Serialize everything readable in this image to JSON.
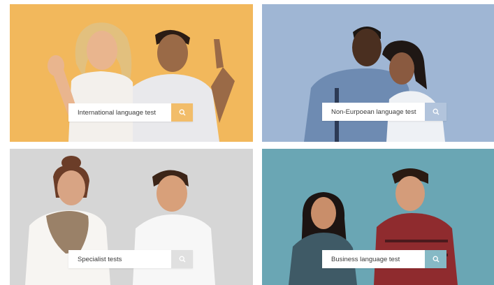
{
  "colors": {
    "card1_bg": "#f2b85c",
    "card2_bg": "#9fb6d4",
    "card3_bg": "#d4d4d4",
    "card4_bg": "#6aa6b4",
    "card1_button": "#f2bd6a",
    "card2_button": "#b2c4dc",
    "card3_button": "#e0e0e0",
    "card4_button": "#86b9c5"
  },
  "cards": [
    {
      "search_label": "International language test",
      "button_icon": "search-icon"
    },
    {
      "search_label": "Non-Eurpoean language test",
      "button_icon": "search-icon"
    },
    {
      "search_label": "Specialist tests",
      "button_icon": "search-icon"
    },
    {
      "search_label": "Business language test",
      "button_icon": "search-icon"
    }
  ]
}
